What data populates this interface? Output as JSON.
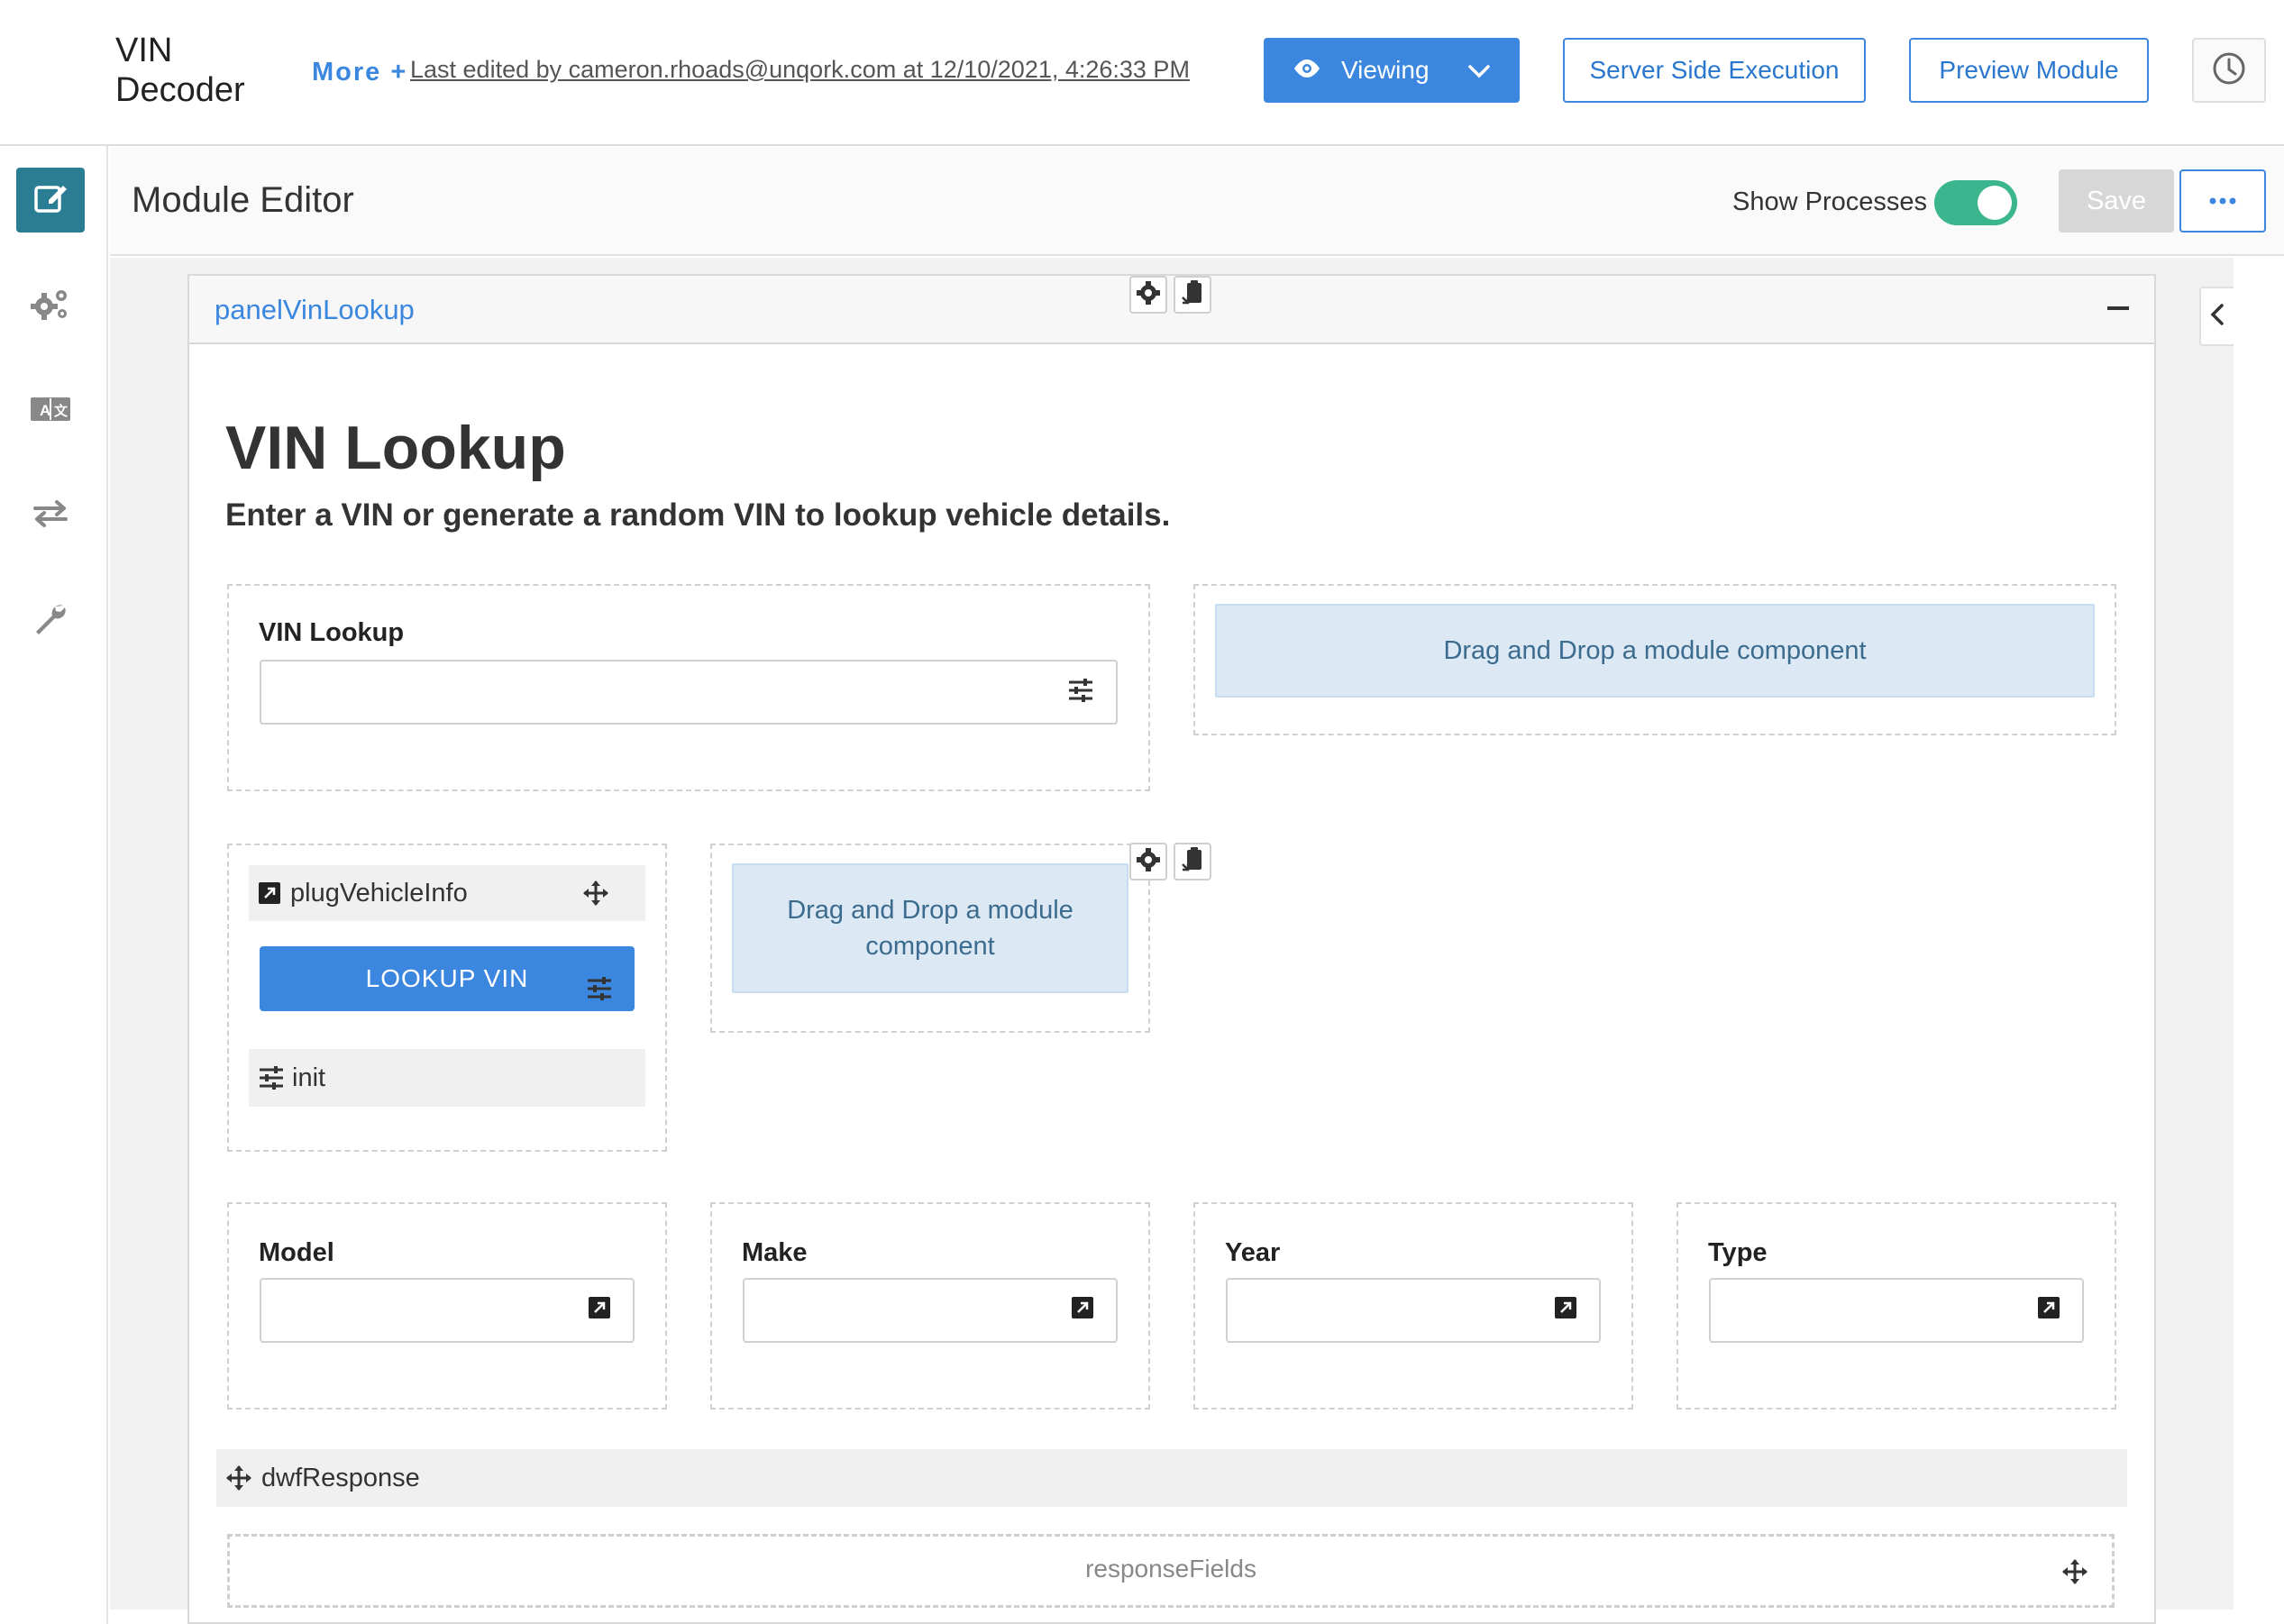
{
  "header": {
    "app_title": "VIN Decoder",
    "more_link": "More +",
    "last_edited": "Last edited by cameron.rhoads@unqork.com at 12/10/2021, 4:26:33 PM",
    "viewing_label": "Viewing",
    "server_side_label": "Server Side Execution",
    "preview_label": "Preview Module",
    "history_icon": "clock-icon"
  },
  "sidebar": {
    "items": [
      {
        "icon": "edit-icon",
        "active": true
      },
      {
        "icon": "gears-icon",
        "active": false
      },
      {
        "icon": "translate-icon",
        "active": false
      },
      {
        "icon": "exchange-icon",
        "active": false
      },
      {
        "icon": "wrench-icon",
        "active": false
      }
    ]
  },
  "editor": {
    "title": "Module Editor",
    "show_processes_label": "Show Processes",
    "show_processes_on": true,
    "save_label": "Save",
    "more_label": "•••"
  },
  "panel": {
    "name": "panelVinLookup",
    "heading": "VIN Lookup",
    "subtitle": "Enter a VIN or generate a random VIN to lookup vehicle details.",
    "vin_field_label": "VIN Lookup",
    "dropzone_text": "Drag and Drop a module component",
    "plug_label": "plugVehicleInfo",
    "lookup_button": "LOOKUP VIN",
    "init_label": "init",
    "fields": [
      "Model",
      "Make",
      "Year",
      "Type"
    ],
    "dwf_label": "dwfResponse",
    "response_label": "responseFields"
  },
  "colors": {
    "accent": "#3b87e0",
    "active_sidebar": "#2b7d94",
    "toggle_on": "#3bb58e",
    "dropzone_bg": "#dce9f5"
  }
}
